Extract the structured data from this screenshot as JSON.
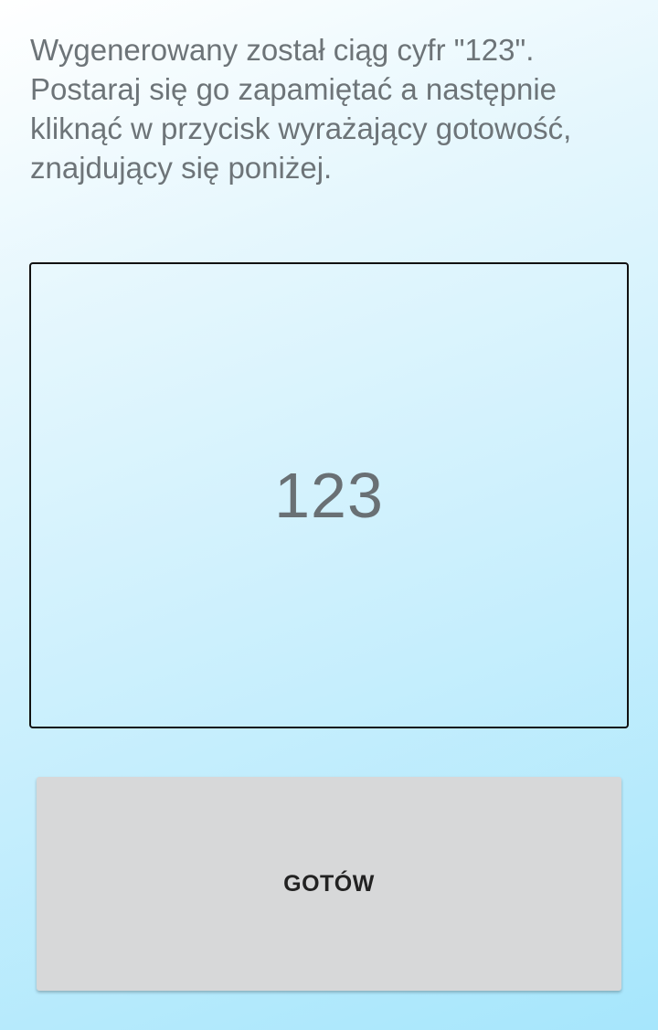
{
  "instructions": {
    "text": "Wygenerowany został ciąg cyfr \"123\". Postaraj się go zapamiętać a następnie kliknąć w przycisk wyrażający gotowość, znajdujący się poniżej."
  },
  "sequence": {
    "value": "123"
  },
  "ready_button": {
    "label": "GOTÓW"
  },
  "colors": {
    "text": "#6d7478",
    "button_bg": "#d7d8d9",
    "gradient_end": "#a6e6fc"
  }
}
